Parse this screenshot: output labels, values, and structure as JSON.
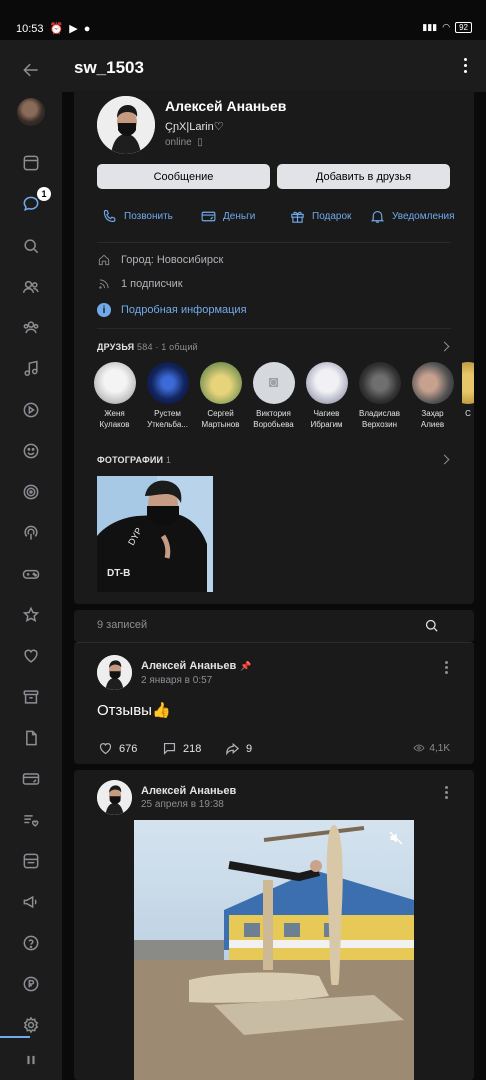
{
  "status_bar": {
    "time": "10:53",
    "battery": "92"
  },
  "header": {
    "title": "sw_1503"
  },
  "rail": {
    "messages_badge": "1"
  },
  "profile": {
    "name": "Алексей Ананьев",
    "status": "ÇɲX|Larin♡",
    "online": "online",
    "message_button": "Сообщение",
    "add_friend_button": "Добавить в друзья",
    "actions": [
      {
        "label": "Позвонить",
        "icon": "phone-icon"
      },
      {
        "label": "Деньги",
        "icon": "money-icon"
      },
      {
        "label": "Подарок",
        "icon": "gift-icon"
      },
      {
        "label": "Уведомления",
        "icon": "bell-icon"
      }
    ],
    "city": "Город: Новосибирск",
    "followers": "1 подписчик",
    "details_link": "Подробная информация"
  },
  "friends": {
    "title": "ДРУЗЬЯ",
    "meta": "584 · 1 общий",
    "items": [
      {
        "first": "Женя",
        "last": "Кулаков"
      },
      {
        "first": "Рустем",
        "last": "Уткельба..."
      },
      {
        "first": "Сергей",
        "last": "Мартынов"
      },
      {
        "first": "Виктория",
        "last": "Воробьева"
      },
      {
        "first": "Чагиев",
        "last": "Ибрагим"
      },
      {
        "first": "Владислав",
        "last": "Верхозин"
      },
      {
        "first": "Заҳар",
        "last": "Алиев"
      },
      {
        "first": "С",
        "last": ""
      }
    ]
  },
  "photos": {
    "title": "ФОТОГРАФИИ",
    "count": "1"
  },
  "posts": {
    "count_label": "9 записей",
    "items": [
      {
        "author": "Алексей Ананьев",
        "date": "2 января в 0:57",
        "text": "Отзывы👍",
        "likes": "676",
        "comments": "218",
        "shares": "9",
        "views": "4,1K"
      },
      {
        "author": "Алексей Ананьев",
        "date": "25 апреля в 19:38"
      }
    ]
  },
  "colors": {
    "accent": "#71aaeb",
    "background": "#0a0a0a",
    "card": "#1a1a1a"
  }
}
